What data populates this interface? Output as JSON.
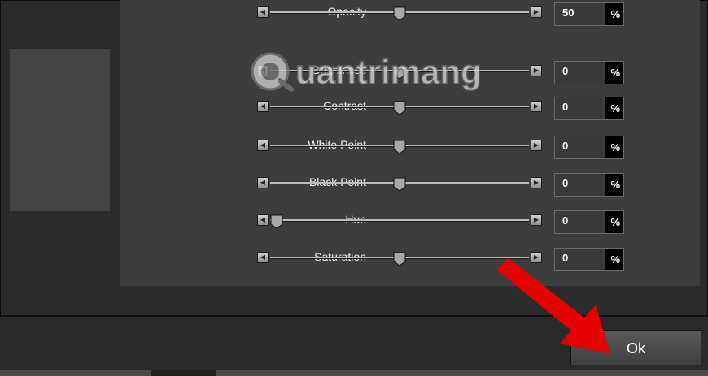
{
  "dialog": {
    "rows": [
      {
        "label": "Opacity",
        "value": "50",
        "unit": "%",
        "position": 0.5
      },
      {
        "label": "Brightness",
        "value": "0",
        "unit": "%",
        "position": 0.5
      },
      {
        "label": "Contrast",
        "value": "0",
        "unit": "%",
        "position": 0.5
      },
      {
        "label": "White Point",
        "value": "0",
        "unit": "%",
        "position": 0.5
      },
      {
        "label": "Black Point",
        "value": "0",
        "unit": "%",
        "position": 0.5
      },
      {
        "label": "Hue",
        "value": "0",
        "unit": "%",
        "position": 0.0
      },
      {
        "label": "Saturation",
        "value": "0",
        "unit": "%",
        "position": 0.5
      }
    ],
    "ok_label": "Ok"
  },
  "watermark": {
    "text": "uantrimang",
    "brand": "Quantrimang"
  },
  "colors": {
    "arrow": "#e60000",
    "panel": "#3d3d3d",
    "background": "#2b2b2b"
  }
}
